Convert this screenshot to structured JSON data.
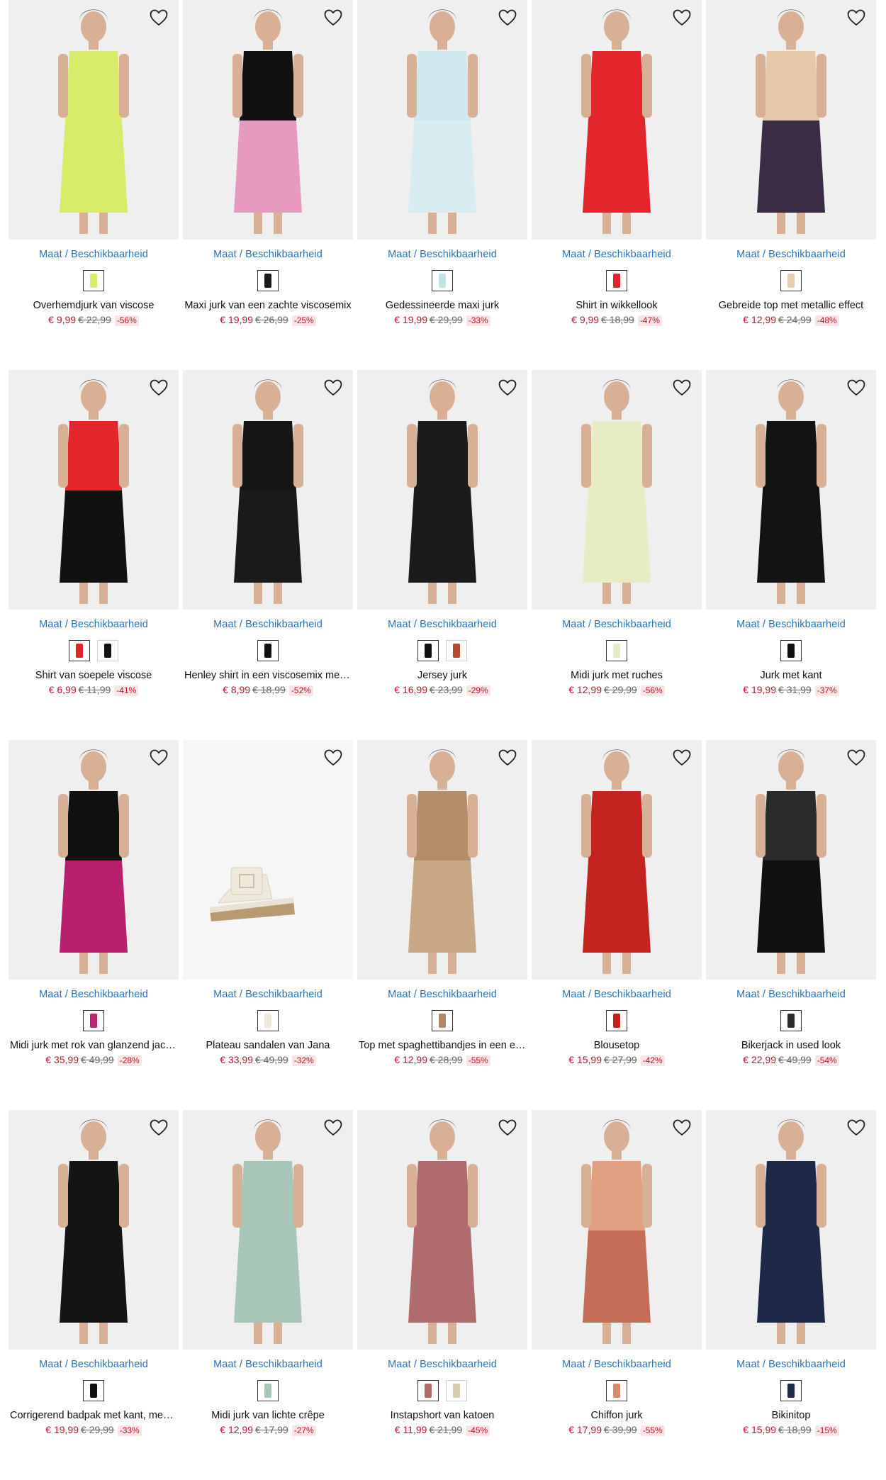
{
  "labels": {
    "size_link": "Maat / Beschikbaarheid"
  },
  "colors": {
    "price_red": "#c8102e",
    "link_blue": "#2a73b8"
  },
  "products": [
    {
      "title": "Overhemdjurk van viscose",
      "price": "€ 9,99",
      "old_price": "€ 22,99",
      "discount": "-56%",
      "swatches": [
        "#d8ec6a"
      ],
      "garment": "#d8ec6a",
      "lower": "#d8ec6a"
    },
    {
      "title": "Maxi jurk van een zachte viscosemix",
      "price": "€ 19,99",
      "old_price": "€ 26,99",
      "discount": "-25%",
      "swatches": [
        "#1a1a1a"
      ],
      "garment": "#111111",
      "lower": "#e79ac0"
    },
    {
      "title": "Gedessineerde maxi jurk",
      "price": "€ 19,99",
      "old_price": "€ 29,99",
      "discount": "-33%",
      "swatches": [
        "#bfe3e3"
      ],
      "garment": "#cfe9ee",
      "lower": "#d9ecf2"
    },
    {
      "title": "Shirt in wikkellook",
      "price": "€ 9,99",
      "old_price": "€ 18,99",
      "discount": "-47%",
      "swatches": [
        "#e0242b"
      ],
      "garment": "#e3262c",
      "lower": "#e3262c"
    },
    {
      "title": "Gebreide top met metallic effect",
      "price": "€ 12,99",
      "old_price": "€ 24,99",
      "discount": "-48%",
      "swatches": [
        "#e8cdb0"
      ],
      "garment": "#e5c9a8",
      "lower": "#3b2c45"
    },
    {
      "title": "Shirt van soepele viscose",
      "price": "€ 6,99",
      "old_price": "€ 11,99",
      "discount": "-41%",
      "swatches": [
        "#e0242b",
        "#111111"
      ],
      "garment": "#e3262c",
      "lower": "#111111"
    },
    {
      "title": "Henley shirt in een viscosemix met ...",
      "price": "€ 8,99",
      "old_price": "€ 18,99",
      "discount": "-52%",
      "swatches": [
        "#111111"
      ],
      "garment": "#151515",
      "lower": "#1a1a1a"
    },
    {
      "title": "Jersey jurk",
      "price": "€ 16,99",
      "old_price": "€ 23,99",
      "discount": "-29%",
      "swatches": [
        "#111111",
        "#b44a2e"
      ],
      "garment": "#1b1b1b",
      "lower": "#1b1b1b"
    },
    {
      "title": "Midi jurk met ruches",
      "price": "€ 12,99",
      "old_price": "€ 29,99",
      "discount": "-56%",
      "swatches": [
        "#e6ebc8"
      ],
      "garment": "#e8ecc4",
      "lower": "#e8ecc4"
    },
    {
      "title": "Jurk met kant",
      "price": "€ 19,99",
      "old_price": "€ 31,99",
      "discount": "-37%",
      "swatches": [
        "#111111"
      ],
      "garment": "#131313",
      "lower": "#131313"
    },
    {
      "title": "Midi jurk met rok van glanzend jacq...",
      "price": "€ 35,99",
      "old_price": "€ 49,99",
      "discount": "-28%",
      "swatches": [
        "#c0256e"
      ],
      "garment": "#111111",
      "lower": "#b81f6c"
    },
    {
      "title": "Plateau sandalen van Jana",
      "price": "€ 33,99",
      "old_price": "€ 49,99",
      "discount": "-32%",
      "swatches": [
        "#efe9dc"
      ],
      "garment": "#efe9dc",
      "lower": "#b89a72"
    },
    {
      "title": "Top met spaghettibandjes in een el...",
      "price": "€ 12,99",
      "old_price": "€ 28,99",
      "discount": "-55%",
      "swatches": [
        "#b08865"
      ],
      "garment": "#b48e6a",
      "lower": "#c9a888"
    },
    {
      "title": "Blousetop",
      "price": "€ 15,99",
      "old_price": "€ 27,99",
      "discount": "-42%",
      "swatches": [
        "#c2211f"
      ],
      "garment": "#c4231f",
      "lower": "#c4231f"
    },
    {
      "title": "Bikerjack in used look",
      "price": "€ 22,99",
      "old_price": "€ 49,99",
      "discount": "-54%",
      "swatches": [
        "#2b2b2b"
      ],
      "garment": "#2a2a2a",
      "lower": "#111111"
    },
    {
      "title": "Corrigerend badpak met kant, med...",
      "price": "€ 19,99",
      "old_price": "€ 29,99",
      "discount": "-33%",
      "swatches": [
        "#111111"
      ],
      "garment": "#141414",
      "lower": "#141414"
    },
    {
      "title": "Midi jurk van lichte crêpe",
      "price": "€ 12,99",
      "old_price": "€ 17,99",
      "discount": "-27%",
      "swatches": [
        "#a8c6b8"
      ],
      "garment": "#a9c7b9",
      "lower": "#a9c7b9"
    },
    {
      "title": "Instapshort van katoen",
      "price": "€ 11,99",
      "old_price": "€ 21,99",
      "discount": "-45%",
      "swatches": [
        "#b46a6a",
        "#d8ccb0"
      ],
      "garment": "#b06b6e",
      "lower": "#b06b6e"
    },
    {
      "title": "Chiffon jurk",
      "price": "€ 17,99",
      "old_price": "€ 39,99",
      "discount": "-55%",
      "swatches": [
        "#d98a6a"
      ],
      "garment": "#e0a081",
      "lower": "#c46e5a"
    },
    {
      "title": "Bikinitop",
      "price": "€ 15,99",
      "old_price": "€ 18,99",
      "discount": "-15%",
      "swatches": [
        "#1f2b4a"
      ],
      "garment": "#1d2947",
      "lower": "#1d2947"
    }
  ]
}
